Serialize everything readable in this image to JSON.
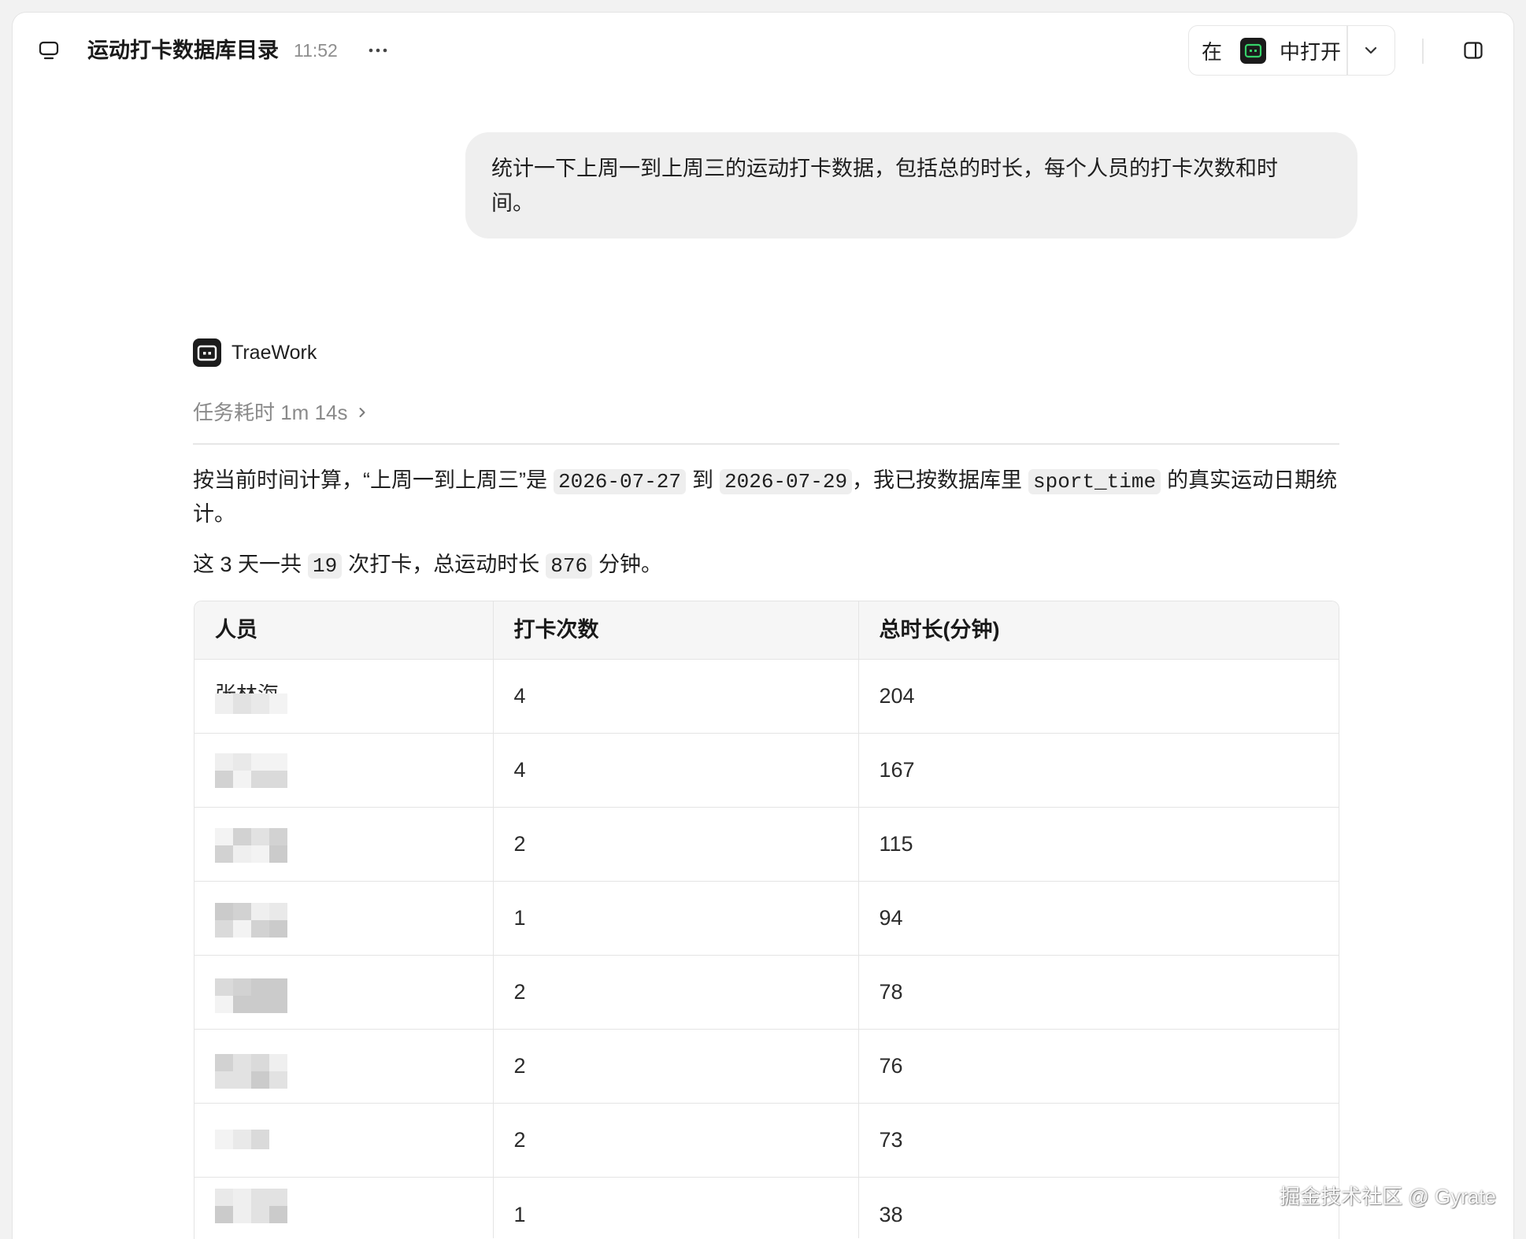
{
  "header": {
    "title": "运动打卡数据库目录",
    "time": "11:52",
    "open_in": {
      "prefix": "在",
      "suffix": "中打开"
    },
    "icons": {
      "conversation": "chat-window-icon",
      "more": "more-icon",
      "app": "trae-app-icon",
      "dropdown": "chevron-down-icon",
      "sidebar": "sidebar-toggle-icon"
    }
  },
  "user_message": {
    "text": "统计一下上周一到上周三的运动打卡数据，包括总的时长，每个人员的打卡次数和时间。"
  },
  "assistant": {
    "name": "TraeWork",
    "logo_icon": "traework-logo-icon",
    "duration": "任务耗时 1m 14s",
    "duration_icon": "chevron-right-icon",
    "paragraph1": {
      "t1": "按当前时间计算，“上周一到上周三”是",
      "c1": "2026-07-27",
      "t2": "到",
      "c2": "2026-07-29",
      "t3": "，我已按数据库里",
      "c3": "sport_time",
      "t4": "的真实运动日期统计。"
    },
    "paragraph2": {
      "t1": "这 3 天一共",
      "c1": "19",
      "t2": "次打卡，总运动时长",
      "c2": "876",
      "t3": "分钟。"
    },
    "table": {
      "headers": [
        "人员",
        "打卡次数",
        "总时长(分钟)"
      ],
      "rows": [
        {
          "name": "张林海",
          "count": "4",
          "minutes": "204"
        },
        {
          "redacted": true,
          "count": "4",
          "minutes": "167"
        },
        {
          "redacted": true,
          "count": "2",
          "minutes": "115"
        },
        {
          "redacted": true,
          "count": "1",
          "minutes": "94"
        },
        {
          "redacted": true,
          "count": "2",
          "minutes": "78"
        },
        {
          "redacted": true,
          "count": "2",
          "minutes": "76"
        },
        {
          "redacted": true,
          "count": "2",
          "minutes": "73"
        },
        {
          "redacted": true,
          "count": "1",
          "minutes": "38"
        }
      ]
    }
  },
  "watermark": "掘金技术社区 @ Gyrate",
  "colors": {
    "brand_green": "#36d26a",
    "bubble_bg": "#efefef",
    "code_bg": "#eeeeee",
    "muted_text": "#8a8a8a"
  }
}
